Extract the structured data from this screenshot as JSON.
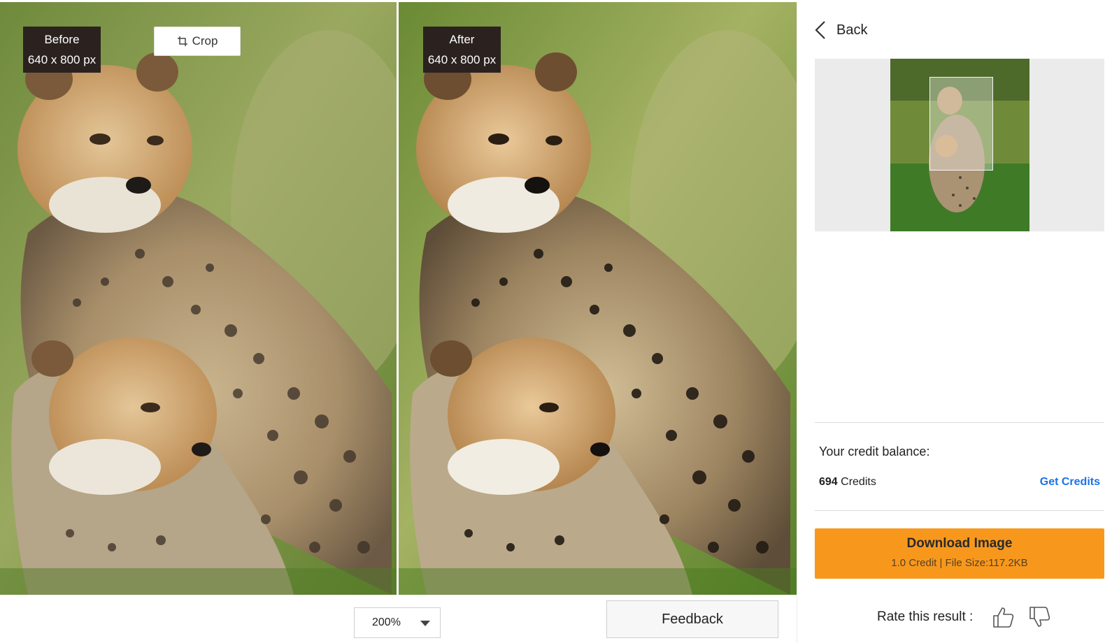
{
  "compare": {
    "before": {
      "label": "Before",
      "size": "640 x 800 px"
    },
    "after": {
      "label": "After",
      "size": "640 x 800 px"
    },
    "crop_label": "Crop",
    "zoom": {
      "selected": "200%"
    },
    "feedback_label": "Feedback"
  },
  "panel": {
    "back_label": "Back",
    "credit": {
      "title": "Your credit balance:",
      "amount": "694",
      "unit": " Credits",
      "get_credits_label": "Get Credits"
    },
    "download": {
      "label": "Download Image",
      "details": "1.0 Credit | File Size:117.2KB"
    },
    "rate_label": "Rate this result :"
  },
  "colors": {
    "accent": "#f7981d",
    "link": "#1a73e8",
    "tag_bg": "#2b2220"
  },
  "icons": [
    "crop-icon",
    "chevron-left-icon",
    "caret-down-icon",
    "thumbs-up-icon",
    "thumbs-down-icon"
  ]
}
